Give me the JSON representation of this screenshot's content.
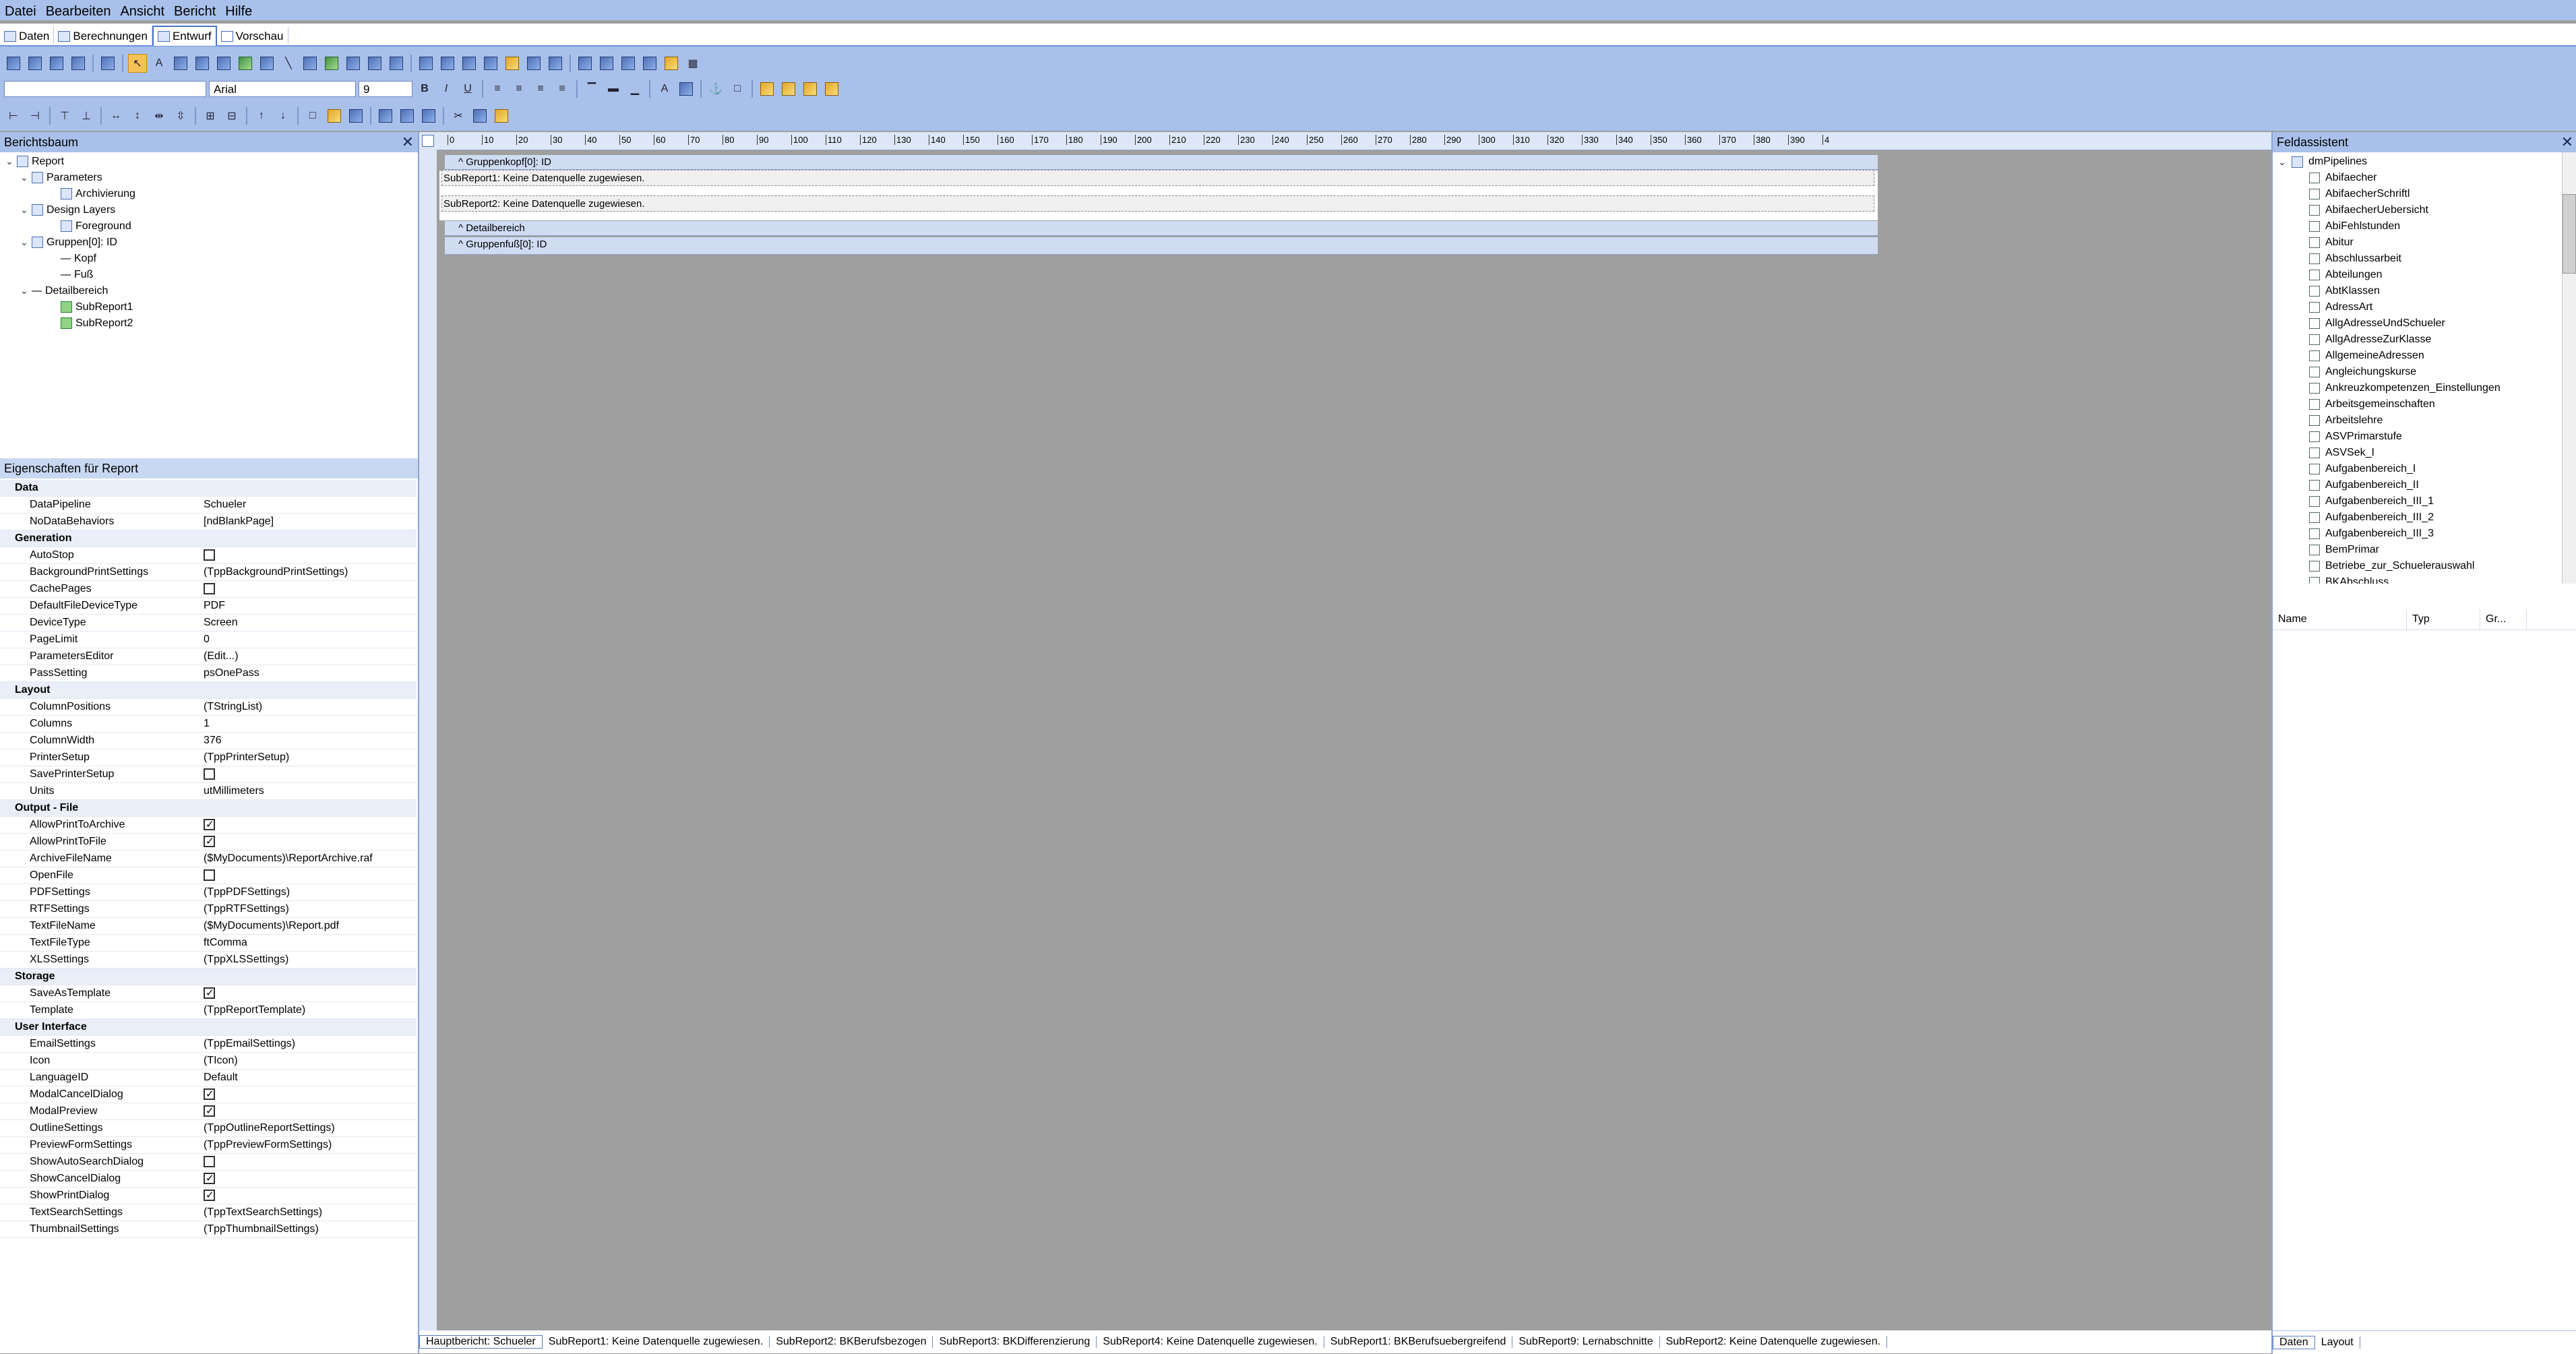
{
  "menu": [
    "Datei",
    "Bearbeiten",
    "Ansicht",
    "Bericht",
    "Hilfe"
  ],
  "view_tabs": [
    {
      "label": "Daten",
      "active": false
    },
    {
      "label": "Berechnungen",
      "active": false
    },
    {
      "label": "Entwurf",
      "active": true
    },
    {
      "label": "Vorschau",
      "active": false
    }
  ],
  "font": {
    "name": "Arial",
    "size": "9"
  },
  "tree": {
    "title": "Berichtsbaum",
    "items": [
      {
        "label": "Report",
        "level": 0
      },
      {
        "label": "Parameters",
        "level": 1
      },
      {
        "label": "Archivierung",
        "level": 2
      },
      {
        "label": "Design Layers",
        "level": 1
      },
      {
        "label": "Foreground",
        "level": 2
      },
      {
        "label": "Gruppen[0]: ID",
        "level": 1
      },
      {
        "label": "Kopf",
        "level": 2
      },
      {
        "label": "Fuß",
        "level": 2
      },
      {
        "label": "Detailbereich",
        "level": 1
      },
      {
        "label": "SubReport1",
        "level": 2
      },
      {
        "label": "SubReport2",
        "level": 2
      }
    ]
  },
  "props": {
    "title": "Eigenschaften für Report",
    "rows": [
      {
        "type": "cat",
        "name": "Data"
      },
      {
        "name": "DataPipeline",
        "value": "Schueler"
      },
      {
        "name": "NoDataBehaviors",
        "value": "[ndBlankPage]",
        "plus": true
      },
      {
        "type": "cat",
        "name": "Generation"
      },
      {
        "name": "AutoStop",
        "check": false
      },
      {
        "name": "BackgroundPrintSettings",
        "value": "(TppBackgroundPrintSettings)",
        "plus": true
      },
      {
        "name": "CachePages",
        "check": false
      },
      {
        "name": "DefaultFileDeviceType",
        "value": "PDF"
      },
      {
        "name": "DeviceType",
        "value": "Screen"
      },
      {
        "name": "PageLimit",
        "value": "0"
      },
      {
        "name": "ParametersEditor",
        "value": "(Edit...)"
      },
      {
        "name": "PassSetting",
        "value": "psOnePass"
      },
      {
        "type": "cat",
        "name": "Layout"
      },
      {
        "name": "ColumnPositions",
        "value": "(TStringList)"
      },
      {
        "name": "Columns",
        "value": "1"
      },
      {
        "name": "ColumnWidth",
        "value": "376"
      },
      {
        "name": "PrinterSetup",
        "value": "(TppPrinterSetup)",
        "plus": true
      },
      {
        "name": "SavePrinterSetup",
        "check": false
      },
      {
        "name": "Units",
        "value": "utMillimeters"
      },
      {
        "type": "cat",
        "name": "Output - File"
      },
      {
        "name": "AllowPrintToArchive",
        "check": true
      },
      {
        "name": "AllowPrintToFile",
        "check": true
      },
      {
        "name": "ArchiveFileName",
        "value": "($MyDocuments)\\ReportArchive.raf"
      },
      {
        "name": "OpenFile",
        "check": false
      },
      {
        "name": "PDFSettings",
        "value": "(TppPDFSettings)",
        "plus": true
      },
      {
        "name": "RTFSettings",
        "value": "(TppRTFSettings)",
        "plus": true
      },
      {
        "name": "TextFileName",
        "value": "($MyDocuments)\\Report.pdf"
      },
      {
        "name": "TextFileType",
        "value": "ftComma"
      },
      {
        "name": "XLSSettings",
        "value": "(TppXLSSettings)",
        "plus": true
      },
      {
        "type": "cat",
        "name": "Storage"
      },
      {
        "name": "SaveAsTemplate",
        "check": true
      },
      {
        "name": "Template",
        "value": "(TppReportTemplate)",
        "plus": true
      },
      {
        "type": "cat",
        "name": "User Interface"
      },
      {
        "name": "EmailSettings",
        "value": "(TppEmailSettings)",
        "plus": true
      },
      {
        "name": "Icon",
        "value": "(TIcon)"
      },
      {
        "name": "LanguageID",
        "value": "Default"
      },
      {
        "name": "ModalCancelDialog",
        "check": true
      },
      {
        "name": "ModalPreview",
        "check": true
      },
      {
        "name": "OutlineSettings",
        "value": "(TppOutlineReportSettings)",
        "plus": true
      },
      {
        "name": "PreviewFormSettings",
        "value": "(TppPreviewFormSettings)",
        "plus": true
      },
      {
        "name": "ShowAutoSearchDialog",
        "check": false
      },
      {
        "name": "ShowCancelDialog",
        "check": true
      },
      {
        "name": "ShowPrintDialog",
        "check": true
      },
      {
        "name": "TextSearchSettings",
        "value": "(TppTextSearchSettings)",
        "plus": true
      },
      {
        "name": "ThumbnailSettings",
        "value": "(TppThumbnailSettings)",
        "plus": true
      }
    ]
  },
  "design": {
    "ruler_marks": [
      "0",
      "10",
      "20",
      "30",
      "40",
      "50",
      "60",
      "70",
      "80",
      "90",
      "100",
      "110",
      "120",
      "130",
      "140",
      "150",
      "160",
      "170",
      "180",
      "190",
      "200",
      "210",
      "220",
      "230",
      "240",
      "250",
      "260",
      "270",
      "280",
      "290",
      "300",
      "310",
      "320",
      "330",
      "340",
      "350",
      "360",
      "370",
      "380",
      "390",
      "4"
    ],
    "group_header": "Gruppenkopf[0]: ID",
    "subreport1": "SubReport1: Keine Datenquelle zugewiesen.",
    "subreport2": "SubReport2: Keine Datenquelle zugewiesen.",
    "detail": "Detailbereich",
    "group_footer": "Gruppenfuß[0]: ID"
  },
  "bottom_tabs": [
    "Hauptbericht: Schueler",
    "SubReport1: Keine Datenquelle zugewiesen.",
    "SubReport2: BKBerufsbezogen",
    "SubReport3: BKDifferenzierung",
    "SubReport4: Keine Datenquelle zugewiesen.",
    "SubReport1: BKBerufsuebergreifend",
    "SubReport9: Lernabschnitte",
    "SubReport2: Keine Datenquelle zugewiesen."
  ],
  "field_assistant": {
    "title": "Feldassistent",
    "root": "dmPipelines",
    "items": [
      "Abifaecher",
      "AbifaecherSchriftl",
      "AbifaecherUebersicht",
      "AbiFehlstunden",
      "Abitur",
      "Abschlussarbeit",
      "Abteilungen",
      "AbtKlassen",
      "AdressArt",
      "AllgAdresseUndSchueler",
      "AllgAdresseZurKlasse",
      "AllgemeineAdressen",
      "Angleichungskurse",
      "Ankreuzkompetenzen_Einstellungen",
      "Arbeitsgemeinschaften",
      "Arbeitslehre",
      "ASVPrimarstufe",
      "ASVSek_I",
      "Aufgabenbereich_I",
      "Aufgabenbereich_II",
      "Aufgabenbereich_III_1",
      "Aufgabenbereich_III_2",
      "Aufgabenbereich_III_3",
      "BemPrimar",
      "Betriebe_zur_Schuelerauswahl",
      "BKAbschluss"
    ],
    "columns": [
      "Name",
      "Typ",
      "Gr..."
    ],
    "bottom_tabs": [
      "Daten",
      "Layout"
    ]
  }
}
